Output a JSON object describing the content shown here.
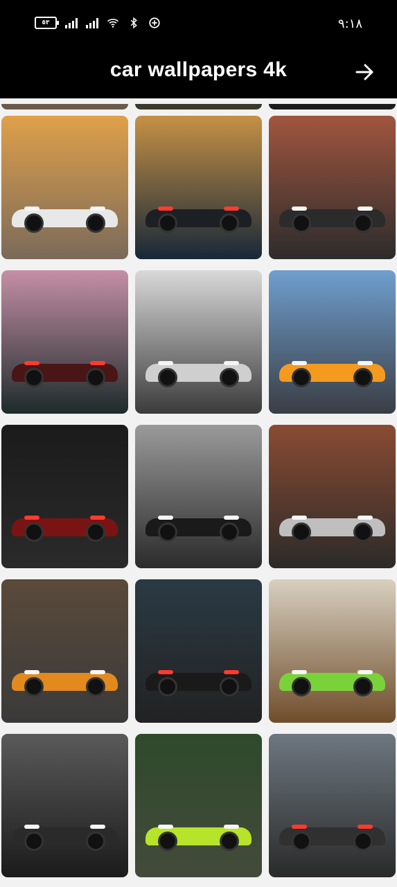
{
  "status_bar": {
    "battery_text": "٥٣",
    "time": "٩:١٨"
  },
  "app_bar": {
    "title": "car wallpapers 4k",
    "next_icon": "arrow-right-icon"
  },
  "wallpapers": [
    {
      "colors": [
        "#e0a04a",
        "#7a6a5a"
      ],
      "car": "#e8e8e8"
    },
    {
      "colors": [
        "#c69145",
        "#182838"
      ],
      "car": "#1c1f24"
    },
    {
      "colors": [
        "#a1553e",
        "#2c2c2c"
      ],
      "car": "#2b2b2b"
    },
    {
      "colors": [
        "#c68fa7",
        "#1d2b2b"
      ],
      "car": "#4a1515"
    },
    {
      "colors": [
        "#d9d9d9",
        "#3b3b3b"
      ],
      "car": "#cfcfcf"
    },
    {
      "colors": [
        "#6f9fcf",
        "#3a3d44"
      ],
      "car": "#f39a1f"
    },
    {
      "colors": [
        "#1b1b1b",
        "#2a2a2a"
      ],
      "car": "#7a1414"
    },
    {
      "colors": [
        "#9a9a9a",
        "#2b2b2b"
      ],
      "car": "#1a1a1a"
    },
    {
      "colors": [
        "#8a4b33",
        "#2c2a28"
      ],
      "car": "#bfbfbf"
    },
    {
      "colors": [
        "#5a4a3a",
        "#3a3a3a"
      ],
      "car": "#e28a1e"
    },
    {
      "colors": [
        "#2a3a44",
        "#222222"
      ],
      "car": "#1a1a1a"
    },
    {
      "colors": [
        "#d8d0c0",
        "#6f4d2b"
      ],
      "car": "#7ad23a"
    },
    {
      "colors": [
        "#5a5a5a",
        "#1b1b1b"
      ],
      "car": "#2a2a2a"
    },
    {
      "colors": [
        "#2e4a2c",
        "#444a3a"
      ],
      "car": "#b7e32b"
    },
    {
      "colors": [
        "#6d7780",
        "#2a2a2a"
      ],
      "car": "#303030"
    }
  ]
}
